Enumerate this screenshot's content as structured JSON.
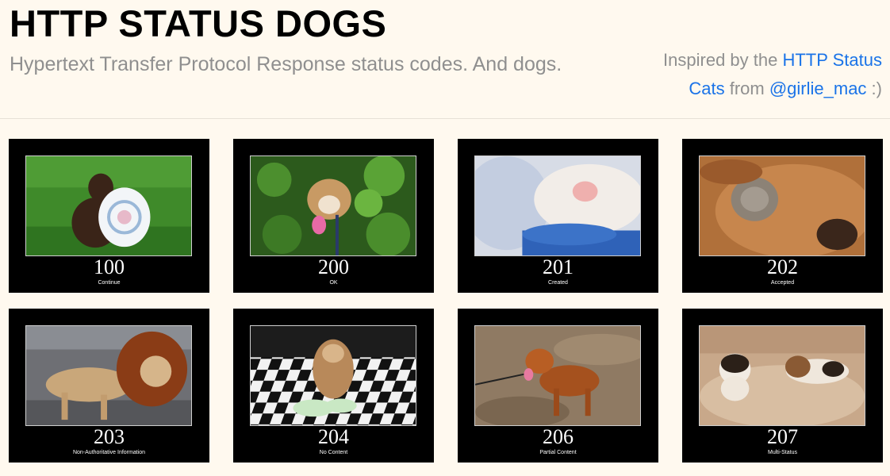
{
  "header": {
    "title": "HTTP STATUS DOGS",
    "tagline": "Hypertext Transfer Protocol Response status codes. And dogs.",
    "credit_prefix": "Inspired by the ",
    "credit_link": "HTTP Status Cats",
    "credit_mid": " from ",
    "credit_handle": "@girlie_mac",
    "credit_suffix": " :)"
  },
  "cards": [
    {
      "code": "100",
      "desc": "Continue"
    },
    {
      "code": "200",
      "desc": "OK"
    },
    {
      "code": "201",
      "desc": "Created"
    },
    {
      "code": "202",
      "desc": "Accepted"
    },
    {
      "code": "203",
      "desc": "Non-Authoritative Information"
    },
    {
      "code": "204",
      "desc": "No Content"
    },
    {
      "code": "206",
      "desc": "Partial Content"
    },
    {
      "code": "207",
      "desc": "Multi-Status"
    }
  ],
  "colors": {
    "background": "#fff9ef",
    "link": "#1a73e8",
    "muted_text": "#8f8f8f",
    "card": "#000000"
  }
}
